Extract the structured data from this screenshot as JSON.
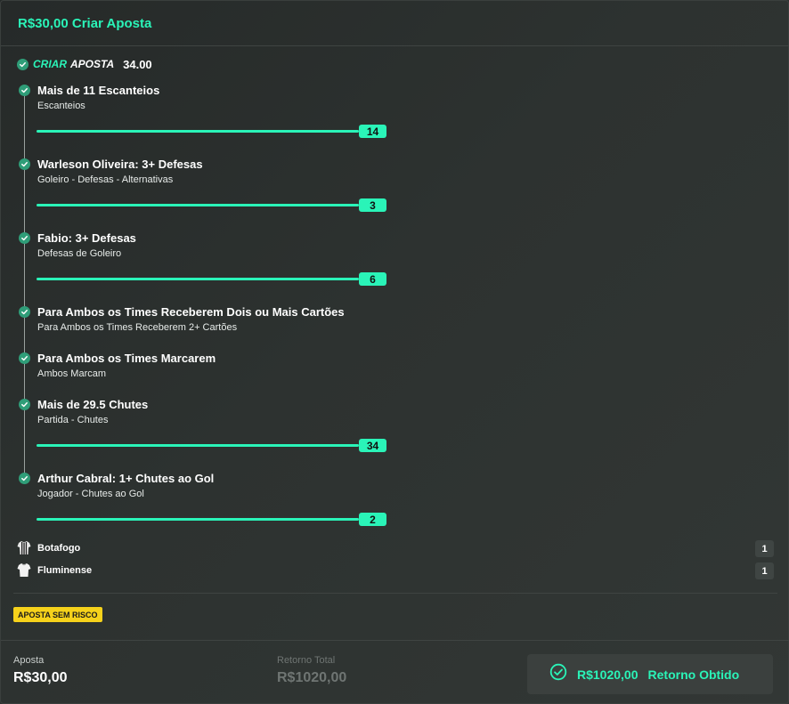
{
  "header": {
    "title": "R$30,00 Criar Aposta"
  },
  "summary": {
    "criar": "CRIAR",
    "aposta": "APOSTA",
    "odds": "34.00"
  },
  "selections": [
    {
      "title": "Mais de 11 Escanteios",
      "subtitle": "Escanteios",
      "progress_value": "14"
    },
    {
      "title": "Warleson Oliveira: 3+ Defesas",
      "subtitle": "Goleiro - Defesas - Alternativas",
      "progress_value": "3"
    },
    {
      "title": "Fabio: 3+ Defesas",
      "subtitle": "Defesas de Goleiro",
      "progress_value": "6"
    },
    {
      "title": "Para Ambos os Times Receberem Dois ou Mais Cartões",
      "subtitle": "Para Ambos os Times Receberem 2+ Cartões"
    },
    {
      "title": "Para Ambos os Times Marcarem",
      "subtitle": "Ambos Marcam"
    },
    {
      "title": "Mais de 29.5 Chutes",
      "subtitle": "Partida - Chutes",
      "progress_value": "34"
    },
    {
      "title": "Arthur Cabral: 1+ Chutes ao Gol",
      "subtitle": "Jogador - Chutes ao Gol",
      "progress_value": "2"
    }
  ],
  "teams": [
    {
      "name": "Botafogo",
      "score": "1",
      "icon": "striped-jersey-icon"
    },
    {
      "name": "Fluminense",
      "score": "1",
      "icon": "jersey-icon"
    }
  ],
  "badge": {
    "label": "APOSTA SEM RISCO"
  },
  "footer": {
    "stake_label": "Aposta",
    "stake_value": "R$30,00",
    "return_label": "Retorno Total",
    "return_value": "R$1020,00",
    "result_amount": "R$1020,00",
    "result_label": "Retorno Obtido"
  },
  "colors": {
    "accent": "#2af4b8",
    "check": "#2f9d78",
    "badge_yellow": "#f6d21b",
    "background": "#2d3230"
  }
}
